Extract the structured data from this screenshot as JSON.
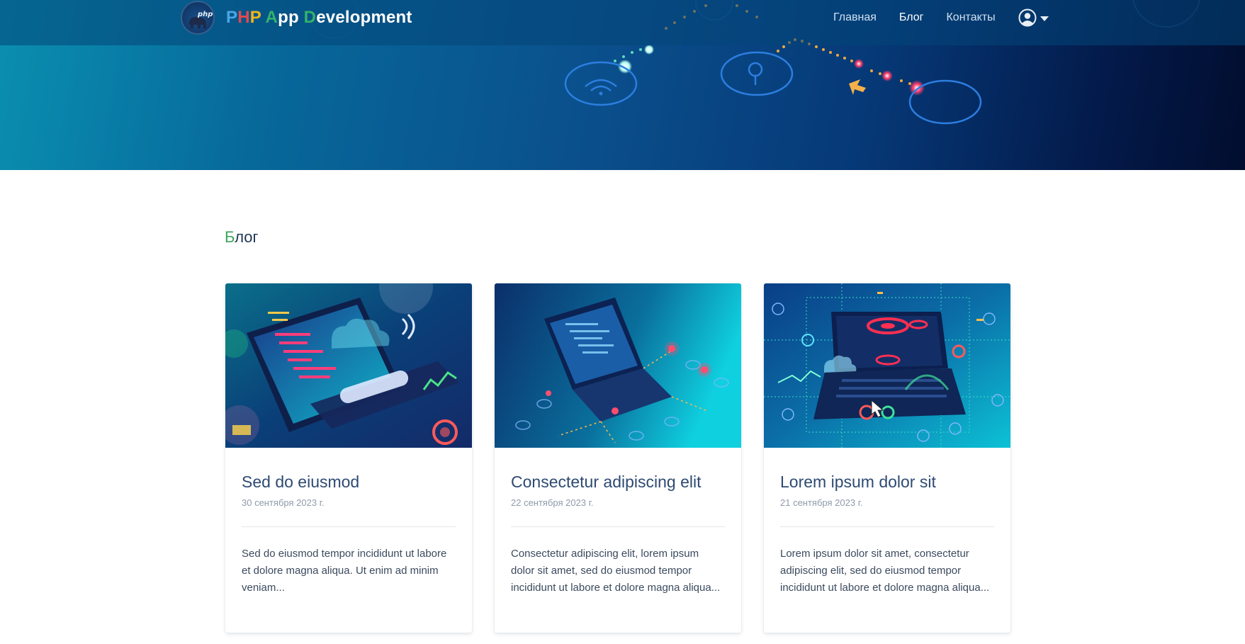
{
  "header": {
    "brand": {
      "letters": [
        {
          "t": "P",
          "cls": "c-p1"
        },
        {
          "t": "H",
          "cls": "c-h"
        },
        {
          "t": "P",
          "cls": "c-p2"
        },
        {
          "t": " ",
          "cls": "c-w"
        },
        {
          "t": "A",
          "cls": "c-a"
        },
        {
          "t": "pp ",
          "cls": "c-w"
        },
        {
          "t": "D",
          "cls": "c-d"
        },
        {
          "t": "evelopment",
          "cls": "c-w"
        }
      ],
      "logo_text": "php"
    },
    "nav": {
      "home": "Главная",
      "blog": "Блог",
      "contacts": "Контакты"
    },
    "user_icon": "user-circle-icon",
    "user_caret_icon": "caret-down-icon"
  },
  "main": {
    "section_title_first": "Б",
    "section_title_rest": "лог",
    "posts": [
      {
        "title": "Sed do eiusmod",
        "date": "30 сентября 2023 г.",
        "excerpt": "Sed do eiusmod tempor incididunt ut labore et dolore magna aliqua. Ut enim ad minim veniam..."
      },
      {
        "title": "Consectetur adipiscing elit",
        "date": "22 сентября 2023 г.",
        "excerpt": "Consectetur adipiscing elit, lorem ipsum dolor sit amet, sed do eiusmod tempor incididunt ut labore et dolore magna aliqua..."
      },
      {
        "title": "Lorem ipsum dolor sit",
        "date": "21 сентября 2023 г.",
        "excerpt": "Lorem ipsum dolor sit amet, consectetur adipiscing elit, sed do eiusmod tempor incididunt ut labore et dolore magna aliqua..."
      }
    ]
  },
  "colors": {
    "accent_green": "#3ba55c",
    "title_blue": "#2e4a73",
    "hero_dark": "#031a4a"
  }
}
